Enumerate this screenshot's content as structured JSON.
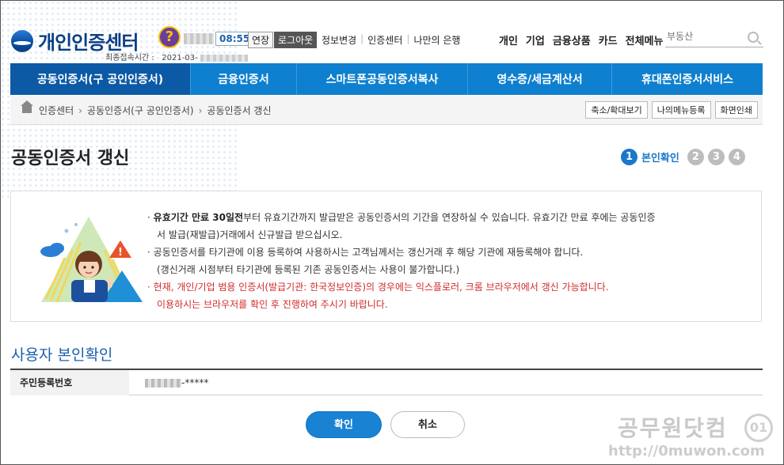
{
  "header": {
    "logo_text": "개인인증센터",
    "help_label": "?",
    "timer": "08:55",
    "extend_label": "연장",
    "logout_label": "로그아웃",
    "top_links": [
      "정보변경",
      "인증센터",
      "나만의 은행"
    ],
    "last_login_label": "최종접속시간 :",
    "last_login_value": "2021-03-",
    "gnb": [
      "개인",
      "기업",
      "금융상품",
      "카드",
      "전체메뉴"
    ],
    "search_placeholder": "부동산"
  },
  "nav": {
    "tabs": [
      {
        "label": "공동인증서(구 공인인증서)",
        "active": true
      },
      {
        "label": "금융인증서",
        "active": false
      },
      {
        "label": "스마트폰공동인증서복사",
        "active": false
      },
      {
        "label": "영수증/세금계산서",
        "active": false
      },
      {
        "label": "휴대폰인증서서비스",
        "active": false
      }
    ]
  },
  "breadcrumb": {
    "items": [
      "인증센터",
      "공동인증서(구 공인인증서)",
      "공동인증서 갱신"
    ],
    "buttons": [
      "축소/확대보기",
      "나의메뉴등록",
      "화면인쇄"
    ]
  },
  "page": {
    "title": "공동인증서 갱신",
    "steps": [
      "1",
      "2",
      "3",
      "4"
    ],
    "current_step_label": "본인확인"
  },
  "notice": {
    "line1_bold": "유효기간 만료 30일전",
    "line1_rest": "부터 유효기간까지 발급받은 공동인증서의 기간을 연장하실 수 있습니다. 유효기간 만료 후에는 공동인증",
    "line1_cont": "서 발급(재발급)거래에서 신규발급 받으십시오.",
    "line2": "공동인증서를 타기관에 이용 등록하여 사용하시는 고객님께서는 갱신거래 후 해당 기관에 재등록해야 합니다.",
    "line2_cont": "(갱신거래 시점부터 타기관에 등록된 기존 공동인증서는 사용이 불가합니다.)",
    "line3": "현재, 개인/기업 범용 인증서(발급기관: 한국정보인증)의 경우에는 익스플로러, 크롬 브라우저에서 갱신 가능합니다.",
    "line3_cont": "이용하시는 브라우저를 확인 후 진행하여 주시기 바랍니다.",
    "bullet": "·"
  },
  "section": {
    "title": "사용자 본인확인",
    "field_label": "주민등록번호",
    "field_value_suffix": "-*****"
  },
  "buttons": {
    "confirm": "확인",
    "cancel": "취소"
  },
  "watermark": {
    "text": "공무원닷컴",
    "url": "http://0muwon.com",
    "badge": "01"
  },
  "colors": {
    "nav_bg": "#0f80cf",
    "nav_active": "#0c5aa6",
    "accent": "#1a78c8",
    "warning_text": "#d22a2a"
  }
}
